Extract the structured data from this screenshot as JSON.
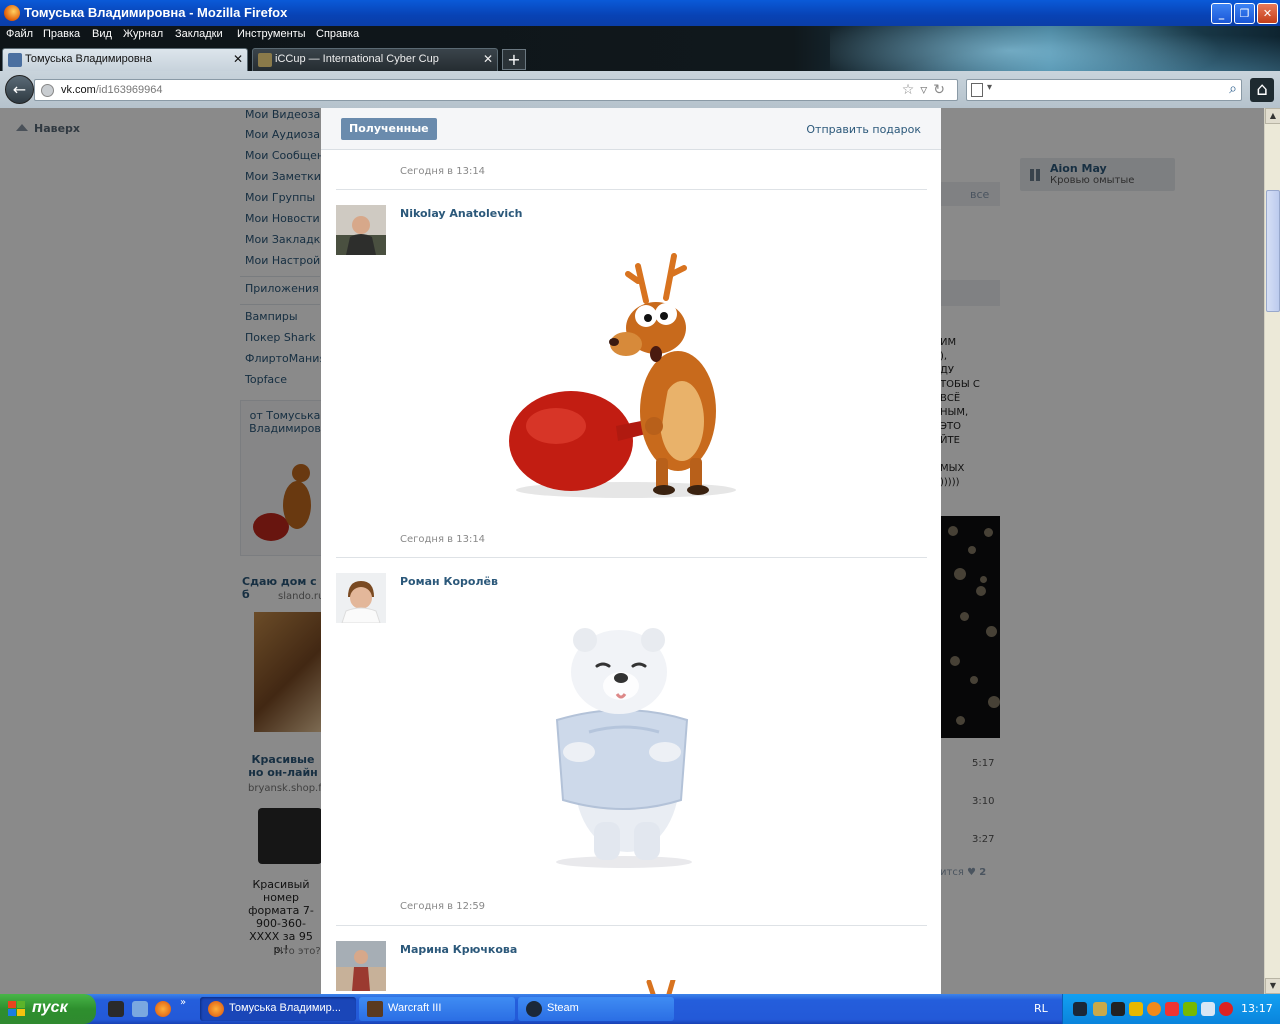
{
  "window": {
    "title": "Томуська Владимировна - Mozilla Firefox"
  },
  "menu": [
    "Файл",
    "Правка",
    "Вид",
    "Журнал",
    "Закладки",
    "Инструменты",
    "Справка"
  ],
  "tabs": [
    {
      "label": "Томуська Владимировна",
      "active": true
    },
    {
      "label": "iCCup — International Cyber Cup",
      "active": false
    }
  ],
  "address": {
    "host": "vk.com",
    "path": "/id163969964"
  },
  "page": {
    "back_to_top": "Наверх",
    "left_menu": [
      "Мои Видеозаписи",
      "Мои Аудиозаписи",
      "Мои Сообщения",
      "Мои Заметки",
      "Мои Группы",
      "Мои Новости",
      "Мои Закладки",
      "Мои Настройки",
      "Приложения",
      "Вампиры",
      "Покер Shark",
      "ФлиртоМания",
      "Topface"
    ],
    "left_gift_text": "от Томуська Владимиров",
    "ads": [
      {
        "title": "Сдаю дом с б",
        "site": "slando.ru"
      },
      {
        "title": "Красивые но он-лайн",
        "site": "bryansk.shop.fe",
        "text": "Красивый номер формата 7-900-360-XXXX за 95 р.!"
      }
    ],
    "ads_help": "Что это?",
    "right_audio": {
      "title": "Aion May",
      "subtitle": "Кровью омытые"
    },
    "all_link": "все",
    "right_text": "ИМ\n),\nДУ\nТОБЫ С\nВСЁ\nНЫМ,\nЭТО\nЙТЕ\n\nМЫХ\n)))))",
    "durations": [
      "5:17",
      "3:10",
      "3:27"
    ],
    "likes_text": "ится",
    "likes_count": "2"
  },
  "modal": {
    "tab_received": "Полученные",
    "send_gift": "Отправить подарок",
    "gifts": [
      {
        "time": "Сегодня в 13:14",
        "sender": "Nikolay Anatolevich",
        "gift": "reindeer-with-bag"
      },
      {
        "time": "Сегодня в 13:14",
        "sender": "Роман Королёв",
        "gift": "polar-bear-with-pillow"
      },
      {
        "time": "Сегодня в 12:59",
        "sender": "Марина Крючкова",
        "gift": "reindeer-with-bag"
      }
    ]
  },
  "taskbar": {
    "start": "пуск",
    "tasks": [
      {
        "label": "Томуська Владимир...",
        "active": true
      },
      {
        "label": "Warcraft III",
        "active": false
      },
      {
        "label": "Steam",
        "active": false
      }
    ],
    "language": "RL",
    "clock": "13:17"
  }
}
